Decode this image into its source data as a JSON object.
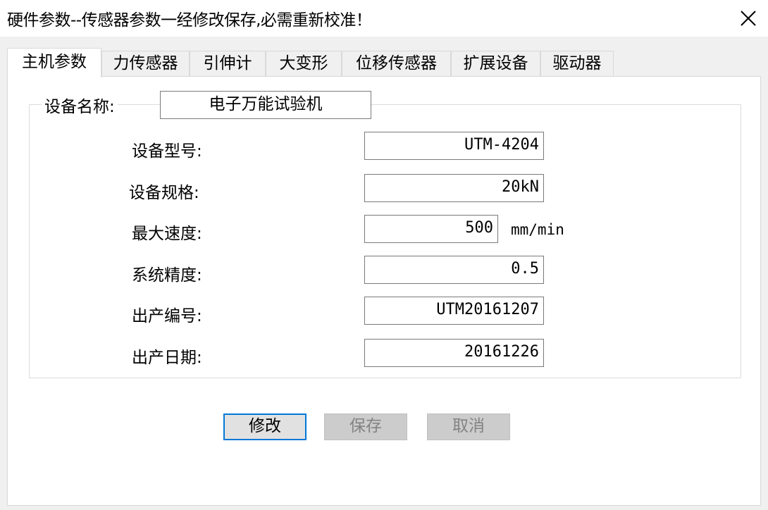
{
  "window": {
    "title": "硬件参数--传感器参数一经修改保存,必需重新校准！"
  },
  "tabs": [
    {
      "label": "主机参数",
      "active": true
    },
    {
      "label": "力传感器",
      "active": false
    },
    {
      "label": "引伸计",
      "active": false
    },
    {
      "label": "大变形",
      "active": false
    },
    {
      "label": "位移传感器",
      "active": false
    },
    {
      "label": "扩展设备",
      "active": false
    },
    {
      "label": "驱动器",
      "active": false
    }
  ],
  "device": {
    "name_label": "设备名称:",
    "name_value": "电子万能试验机",
    "fields": [
      {
        "label": "设备型号:",
        "value": "UTM-4204",
        "unit": ""
      },
      {
        "label": "设备规格:",
        "value": "20kN",
        "unit": ""
      },
      {
        "label": "最大速度:",
        "value": "500",
        "unit": "mm/min"
      },
      {
        "label": "系统精度:",
        "value": "0.5",
        "unit": ""
      },
      {
        "label": "出产编号:",
        "value": "UTM20161207",
        "unit": ""
      },
      {
        "label": "出产日期:",
        "value": "20161226",
        "unit": ""
      }
    ]
  },
  "buttons": {
    "modify": "修改",
    "save": "保存",
    "cancel": "取消"
  },
  "colors": {
    "accent": "#0078d7",
    "disabled_bg": "#cccccc",
    "disabled_text": "#838383"
  },
  "icons": {
    "close": "close-icon"
  }
}
